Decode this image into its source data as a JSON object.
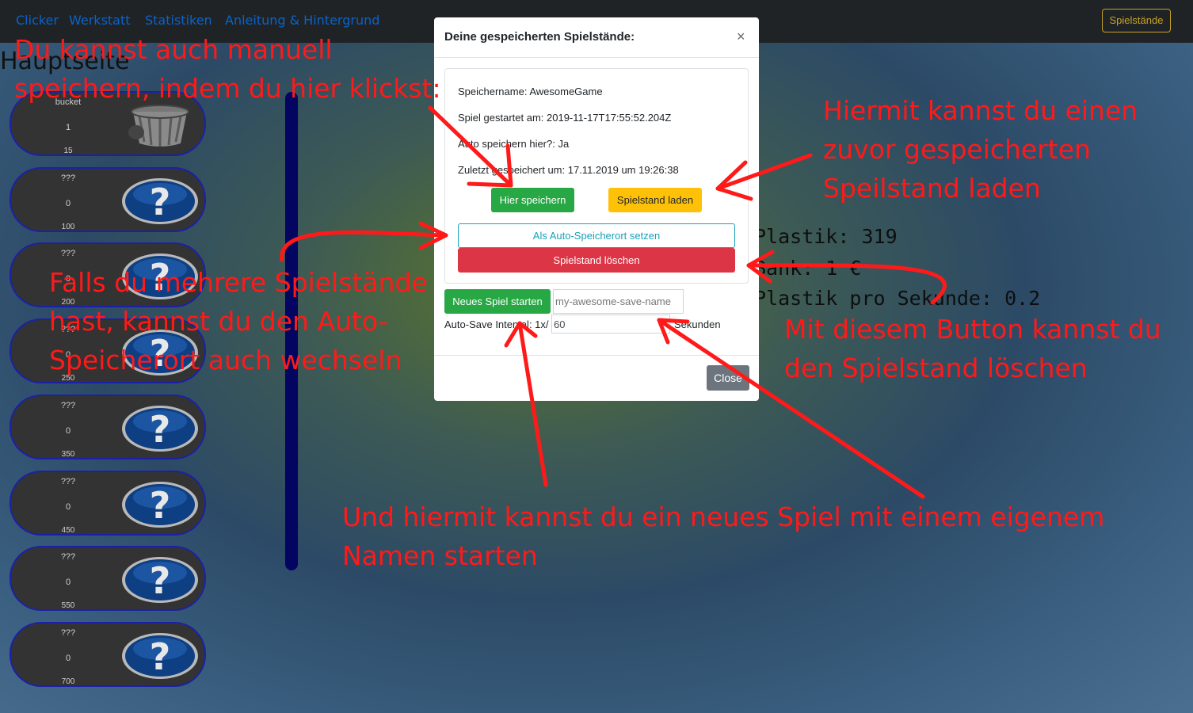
{
  "nav": {
    "links": [
      "Clicker",
      "Werkstatt",
      "Statistiken",
      "Anleitung & Hintergrund"
    ],
    "saves_button": "Spielstände"
  },
  "page_title": "Hauptseite",
  "upgrades": [
    {
      "name": "bucket",
      "count": "1",
      "cost": "15",
      "icon": "bucket-icon"
    },
    {
      "name": "???",
      "count": "0",
      "cost": "100",
      "icon": "question-icon"
    },
    {
      "name": "???",
      "count": "0",
      "cost": "200",
      "icon": "question-icon"
    },
    {
      "name": "???",
      "count": "0",
      "cost": "250",
      "icon": "question-icon"
    },
    {
      "name": "???",
      "count": "0",
      "cost": "350",
      "icon": "question-icon"
    },
    {
      "name": "???",
      "count": "0",
      "cost": "450",
      "icon": "question-icon"
    },
    {
      "name": "???",
      "count": "0",
      "cost": "550",
      "icon": "question-icon"
    },
    {
      "name": "???",
      "count": "0",
      "cost": "700",
      "icon": "question-icon"
    }
  ],
  "stats": {
    "plastik": "Plastik: 319",
    "bank": "Bank: 1 €",
    "per_second": "Plastik pro Sekunde: 0.2"
  },
  "modal": {
    "title": "Deine gespeicherten Spielstände:",
    "close_x": "×",
    "save_name": "Speichername: AwesomeGame",
    "started": "Spiel gestartet am: 2019-11-17T17:55:52.204Z",
    "auto_here": "Auto speichern hier?: Ja",
    "last_saved": "Zuletzt gespeichert um: 17.11.2019 um 19:26:38",
    "save_here_btn": "Hier speichern",
    "load_btn": "Spielstand laden",
    "set_auto_btn": "Als Auto-Speicherort setzen",
    "delete_btn": "Spielstand löschen",
    "new_game_btn": "Neues Spiel starten",
    "new_game_placeholder": "my-awesome-save-name",
    "interval_label": "Auto-Save Interval: 1x/",
    "interval_value": "60",
    "seconds_label": "Sekunden",
    "close_btn": "Close"
  },
  "annotations": {
    "manual_save": [
      "Du kannst auch manuell",
      "speichern, indem du hier klickst:"
    ],
    "load": [
      "Hiermit kannst du einen",
      "zuvor gespeicherten",
      "Speilstand laden"
    ],
    "switch_auto": [
      "Falls du mehrere Spielstände",
      "hast, kannst du den Auto-",
      "Speicherort auch wechseln"
    ],
    "delete": [
      "Mit diesem Button kannst du",
      "den Spielstand löschen"
    ],
    "new_game": [
      "Und hiermit kannst du ein neues Spiel mit einem eigenem",
      "Namen starten"
    ]
  },
  "colors": {
    "annotation_red": "#ff1a1a",
    "btn_green": "#28a745",
    "btn_yellow": "#ffc107",
    "btn_red": "#dc3545",
    "btn_info": "#17a2b8",
    "nav_link_blue": "#0b63c8"
  }
}
